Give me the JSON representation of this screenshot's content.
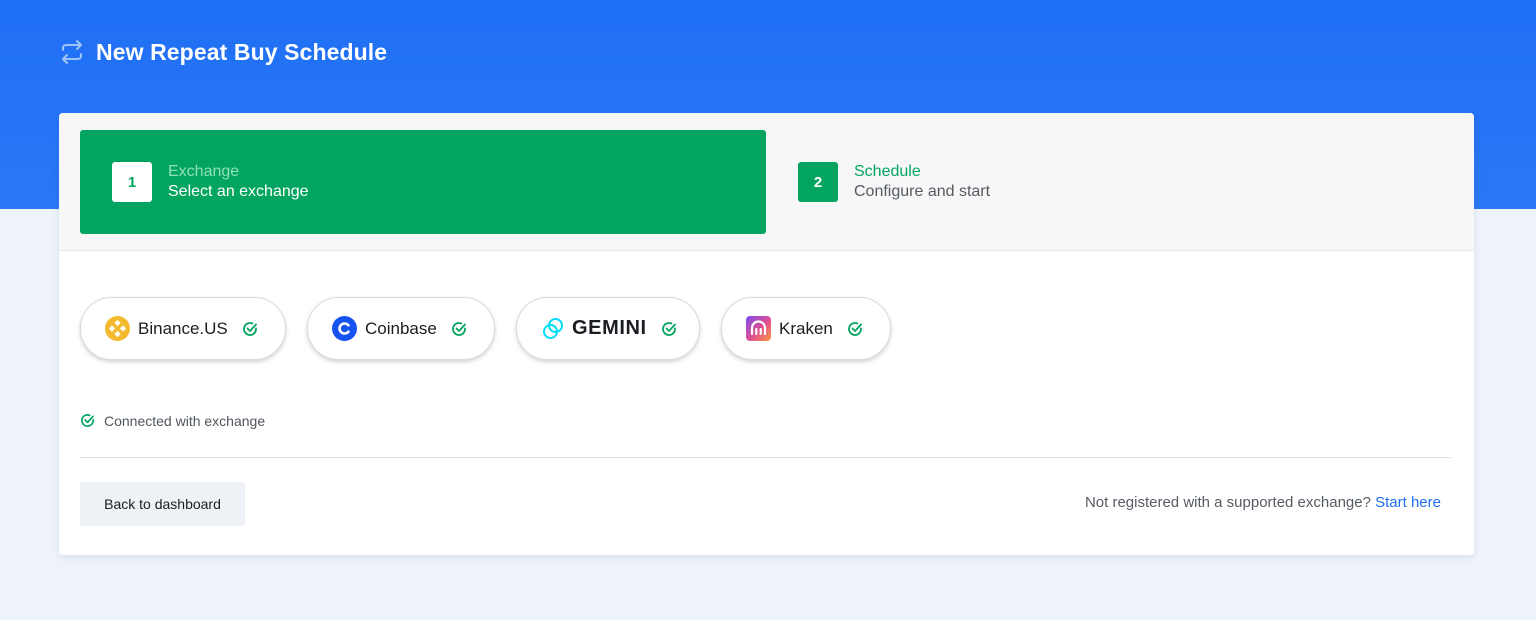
{
  "header": {
    "title": "New Repeat Buy Schedule",
    "icon": "repeat-icon"
  },
  "steps": [
    {
      "number": "1",
      "title": "Exchange",
      "subtitle": "Select an exchange",
      "active": true
    },
    {
      "number": "2",
      "title": "Schedule",
      "subtitle": "Configure and start",
      "active": false
    }
  ],
  "exchanges": [
    {
      "name": "Binance.US",
      "icon": "binance-logo-icon",
      "connected": true
    },
    {
      "name": "Coinbase",
      "icon": "coinbase-logo-icon",
      "connected": true
    },
    {
      "name": "GEMINI",
      "icon": "gemini-logo-icon",
      "connected": true
    },
    {
      "name": "Kraken",
      "icon": "kraken-logo-icon",
      "connected": true
    }
  ],
  "legend": {
    "connected_label": "Connected with exchange"
  },
  "footer": {
    "back_label": "Back to dashboard",
    "not_registered_text": "Not registered with a supported exchange?",
    "start_here_label": "Start here"
  },
  "colors": {
    "brand_blue": "#1f6ff5",
    "success_green": "#02a55f",
    "page_bg": "#eef3fb"
  }
}
